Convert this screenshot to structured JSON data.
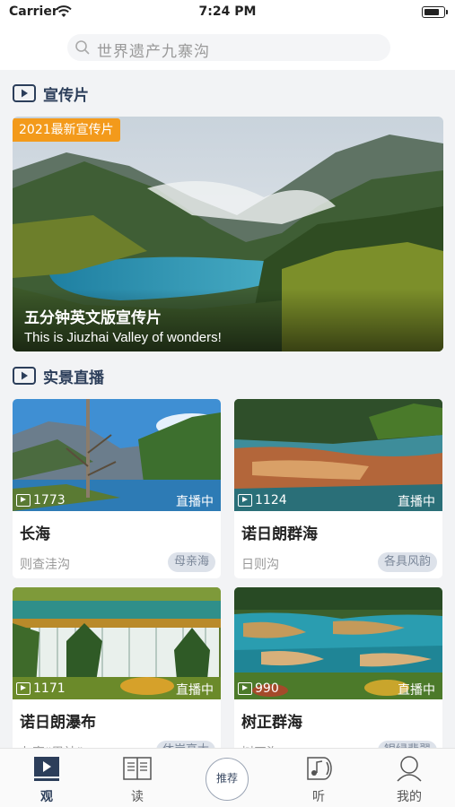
{
  "status_bar": {
    "carrier": "Carrier",
    "time": "7:24 PM"
  },
  "search": {
    "placeholder": "世界遗产九寨沟"
  },
  "sections": {
    "promo_title": "宣传片",
    "live_title": "实景直播"
  },
  "promo": {
    "badge": "2021最新宣传片",
    "title": "五分钟英文版宣传片",
    "subtitle": "This is Jiuzhai Valley of wonders!"
  },
  "live_cards": [
    {
      "views": "1773",
      "status": "直播中",
      "name": "长海",
      "location": "则查洼沟",
      "tag": "母亲海"
    },
    {
      "views": "1124",
      "status": "直播中",
      "name": "诺日朗群海",
      "location": "日则沟",
      "tag": "各具风韵"
    },
    {
      "views": "1171",
      "status": "直播中",
      "name": "诺日朗瀑布",
      "location": "九寨“男神”",
      "tag": "休岸高大"
    },
    {
      "views": "990",
      "status": "直播中",
      "name": "树正群海",
      "location": "树正沟",
      "tag": "银绿翡翠"
    }
  ],
  "tabbar": {
    "tabs": [
      {
        "label": "观",
        "icon": "video-icon"
      },
      {
        "label": "读",
        "icon": "book-icon"
      },
      {
        "label": "推荐",
        "icon": "recommend-icon"
      },
      {
        "label": "听",
        "icon": "music-icon"
      },
      {
        "label": "我的",
        "icon": "user-icon"
      }
    ],
    "active_index": 0
  },
  "colors": {
    "accent": "#2c3e5a",
    "badge": "#f39a1b",
    "tag_bg": "#dde2ea",
    "tag_text": "#7b8799"
  }
}
